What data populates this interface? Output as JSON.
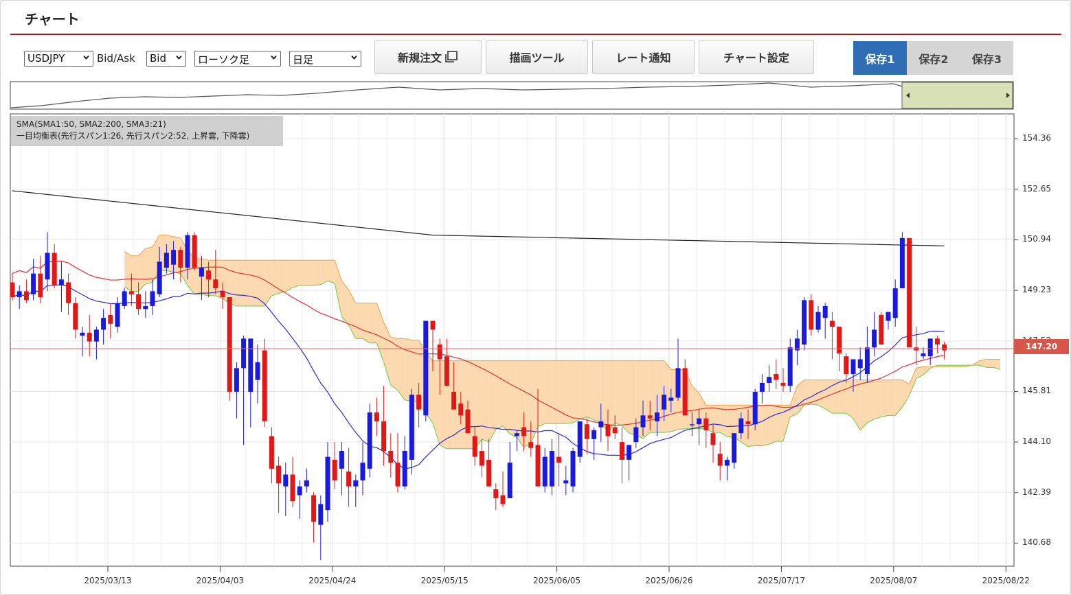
{
  "page_title": "チャート",
  "toolbar": {
    "symbol": "USDJPY",
    "bidask_label": "Bid/Ask",
    "bidask_value": "Bid",
    "chart_type": "ローソク足",
    "period": "日足",
    "new_order": "新規注文",
    "draw_tools": "描画ツール",
    "rate_alert": "レート通知",
    "chart_settings": "チャート設定",
    "save1": "保存1",
    "save2": "保存2",
    "save3": "保存3"
  },
  "legend": {
    "line1": "SMA(SMA1:50, SMA2:200, SMA3:21)",
    "line2": "一目均衡表(先行スパン1:26, 先行スパン2:52, 上昇雲, 下降雲)"
  },
  "current_price": "147.20",
  "icons": {
    "new_order_icon": "window-open-icon",
    "dropdown": "chevron-down-icon"
  },
  "colors": {
    "active_save": "#2f6db5",
    "up_candle": "#1a1adf",
    "down_candle": "#e01818",
    "bull_cloud": "#b6f0a8",
    "bear_cloud": "#fdd9b0",
    "price_line": "#d8554a"
  },
  "chart_data": {
    "type": "candlestick",
    "y_ticks": [
      "154.36",
      "152.65",
      "150.94",
      "149.23",
      "147.52",
      "145.81",
      "144.10",
      "142.39",
      "140.68"
    ],
    "ylim": [
      139.9,
      155.2
    ],
    "x_ticks": [
      "2025/03/13",
      "2025/04/03",
      "2025/04/24",
      "2025/05/15",
      "2025/06/05",
      "2025/06/26",
      "2025/07/17",
      "2025/08/07",
      "2025/08/22"
    ],
    "current_price": 147.2,
    "candles_ohlc": [
      [
        149.5,
        149.8,
        148.9,
        149.0
      ],
      [
        149.0,
        149.4,
        148.6,
        149.2
      ],
      [
        149.2,
        149.6,
        148.8,
        148.9
      ],
      [
        149.1,
        150.3,
        148.9,
        149.8
      ],
      [
        149.8,
        150.4,
        148.8,
        149.0
      ],
      [
        149.6,
        151.2,
        149.2,
        150.5
      ],
      [
        150.5,
        150.8,
        149.3,
        149.4
      ],
      [
        149.4,
        150.2,
        148.5,
        149.6
      ],
      [
        149.5,
        149.8,
        148.4,
        148.8
      ],
      [
        148.8,
        149.0,
        147.6,
        147.9
      ],
      [
        147.7,
        148.0,
        147.0,
        147.8
      ],
      [
        147.8,
        148.4,
        147.0,
        147.5
      ],
      [
        147.5,
        148.0,
        146.9,
        147.9
      ],
      [
        147.9,
        148.6,
        147.4,
        148.3
      ],
      [
        148.4,
        148.8,
        147.6,
        148.1
      ],
      [
        148.0,
        149.0,
        147.8,
        148.8
      ],
      [
        148.7,
        149.3,
        148.6,
        149.2
      ],
      [
        149.2,
        149.8,
        148.7,
        149.1
      ],
      [
        149.1,
        149.5,
        148.4,
        148.6
      ],
      [
        148.6,
        149.2,
        148.3,
        148.7
      ],
      [
        148.7,
        149.6,
        148.4,
        149.2
      ],
      [
        149.1,
        150.7,
        149.0,
        150.2
      ],
      [
        150.0,
        150.8,
        149.8,
        150.5
      ],
      [
        150.1,
        150.9,
        149.6,
        150.6
      ],
      [
        150.6,
        150.7,
        149.5,
        150.0
      ],
      [
        150.0,
        151.2,
        149.6,
        151.1
      ],
      [
        151.1,
        151.2,
        149.9,
        150.0
      ],
      [
        149.7,
        150.4,
        148.9,
        150.0
      ],
      [
        149.9,
        150.2,
        149.0,
        149.6
      ],
      [
        149.6,
        150.6,
        149.1,
        149.3
      ],
      [
        149.2,
        149.5,
        148.6,
        149.0
      ],
      [
        149.0,
        149.0,
        145.5,
        145.8
      ],
      [
        145.8,
        146.8,
        144.9,
        146.6
      ],
      [
        146.6,
        147.7,
        144.0,
        147.6
      ],
      [
        145.8,
        147.2,
        144.6,
        147.6
      ],
      [
        146.2,
        147.4,
        145.4,
        146.8
      ],
      [
        147.2,
        147.6,
        144.6,
        144.8
      ],
      [
        144.3,
        144.6,
        142.7,
        143.2
      ],
      [
        143.3,
        143.6,
        141.7,
        142.7
      ],
      [
        142.6,
        143.4,
        141.6,
        143.0
      ],
      [
        143.0,
        143.6,
        141.9,
        142.1
      ],
      [
        142.3,
        142.8,
        141.5,
        142.6
      ],
      [
        142.6,
        143.2,
        142.4,
        142.8
      ],
      [
        142.3,
        142.4,
        140.7,
        141.4
      ],
      [
        141.3,
        142.3,
        140.1,
        142.0
      ],
      [
        141.8,
        144.1,
        141.4,
        143.6
      ],
      [
        143.5,
        144.1,
        142.5,
        142.8
      ],
      [
        143.2,
        144.1,
        142.3,
        143.8
      ],
      [
        143.1,
        143.9,
        141.9,
        142.6
      ],
      [
        142.6,
        143.0,
        141.9,
        142.8
      ],
      [
        142.8,
        144.1,
        142.3,
        143.4
      ],
      [
        143.2,
        145.4,
        142.9,
        145.1
      ],
      [
        145.1,
        145.6,
        144.3,
        144.8
      ],
      [
        144.8,
        146.0,
        143.3,
        143.8
      ],
      [
        143.8,
        144.4,
        142.9,
        143.4
      ],
      [
        143.4,
        144.4,
        142.4,
        142.6
      ],
      [
        142.6,
        144.3,
        142.5,
        143.8
      ],
      [
        143.5,
        145.9,
        143.0,
        145.7
      ],
      [
        145.7,
        146.1,
        144.6,
        145.2
      ],
      [
        145.0,
        148.0,
        144.8,
        148.2
      ],
      [
        148.2,
        148.2,
        146.5,
        147.9
      ],
      [
        147.4,
        147.6,
        145.7,
        146.9
      ],
      [
        147.0,
        147.6,
        146.0,
        146.0
      ],
      [
        145.8,
        146.8,
        145.5,
        145.2
      ],
      [
        145.4,
        145.8,
        144.7,
        145.0
      ],
      [
        145.2,
        145.5,
        144.4,
        144.4
      ],
      [
        144.3,
        144.6,
        143.3,
        143.6
      ],
      [
        143.8,
        144.2,
        142.9,
        143.3
      ],
      [
        143.5,
        144.2,
        142.6,
        142.6
      ],
      [
        142.5,
        142.7,
        141.8,
        142.2
      ],
      [
        142.3,
        143.1,
        141.9,
        142.0
      ],
      [
        142.2,
        144.1,
        142.2,
        143.4
      ],
      [
        144.3,
        144.5,
        143.8,
        144.4
      ],
      [
        144.6,
        145.1,
        143.8,
        144.3
      ],
      [
        144.1,
        144.8,
        143.6,
        143.9
      ],
      [
        144.0,
        145.9,
        143.0,
        142.6
      ],
      [
        142.6,
        143.9,
        142.4,
        143.6
      ],
      [
        142.6,
        144.2,
        142.3,
        143.8
      ],
      [
        143.6,
        144.4,
        142.6,
        143.4
      ],
      [
        142.7,
        143.3,
        142.3,
        142.8
      ],
      [
        142.6,
        143.9,
        142.4,
        143.8
      ],
      [
        143.6,
        144.8,
        143.4,
        144.8
      ],
      [
        144.7,
        144.9,
        143.7,
        144.2
      ],
      [
        144.2,
        144.6,
        143.5,
        144.5
      ],
      [
        144.6,
        145.4,
        144.1,
        144.8
      ],
      [
        144.7,
        145.2,
        143.8,
        144.3
      ],
      [
        144.6,
        145.0,
        144.2,
        144.4
      ],
      [
        144.1,
        144.6,
        142.7,
        143.5
      ],
      [
        143.5,
        144.0,
        142.8,
        144.0
      ],
      [
        144.1,
        144.9,
        143.9,
        144.6
      ],
      [
        144.6,
        145.5,
        144.3,
        145.0
      ],
      [
        145.0,
        145.5,
        144.5,
        144.9
      ],
      [
        144.8,
        145.7,
        144.3,
        145.1
      ],
      [
        145.2,
        146.0,
        144.8,
        145.7
      ],
      [
        145.5,
        145.9,
        145.1,
        145.6
      ],
      [
        145.6,
        147.6,
        145.5,
        146.6
      ],
      [
        146.6,
        146.9,
        145.6,
        145.0
      ],
      [
        144.7,
        145.1,
        144.3,
        144.7
      ],
      [
        144.7,
        145.2,
        144.0,
        144.9
      ],
      [
        144.9,
        145.1,
        143.9,
        144.5
      ],
      [
        144.4,
        144.7,
        143.4,
        144.0
      ],
      [
        143.7,
        144.1,
        142.8,
        143.3
      ],
      [
        143.3,
        143.6,
        142.8,
        143.5
      ],
      [
        143.4,
        144.1,
        143.2,
        144.4
      ],
      [
        144.4,
        145.1,
        144.2,
        144.9
      ],
      [
        144.8,
        145.2,
        144.2,
        144.7
      ],
      [
        144.7,
        145.9,
        144.5,
        145.8
      ],
      [
        145.8,
        146.4,
        145.4,
        146.1
      ],
      [
        146.1,
        146.7,
        145.8,
        146.3
      ],
      [
        146.4,
        146.9,
        145.9,
        146.2
      ],
      [
        146.1,
        146.6,
        145.8,
        146.0
      ],
      [
        146.0,
        147.6,
        145.8,
        147.3
      ],
      [
        147.2,
        147.9,
        146.7,
        147.6
      ],
      [
        147.4,
        149.0,
        147.2,
        148.9
      ],
      [
        148.9,
        149.1,
        147.7,
        147.9
      ],
      [
        147.9,
        148.7,
        147.8,
        148.5
      ],
      [
        148.3,
        148.8,
        147.6,
        148.7
      ],
      [
        148.2,
        148.5,
        146.9,
        148.0
      ],
      [
        148.0,
        148.0,
        146.5,
        147.1
      ],
      [
        147.0,
        147.1,
        146.1,
        146.4
      ],
      [
        146.4,
        146.9,
        145.8,
        146.9
      ],
      [
        146.6,
        147.3,
        146.2,
        146.9
      ],
      [
        146.4,
        148.0,
        146.1,
        147.3
      ],
      [
        147.3,
        148.5,
        147.0,
        147.9
      ],
      [
        148.4,
        148.5,
        147.7,
        147.4
      ],
      [
        148.2,
        148.4,
        147.9,
        148.5
      ],
      [
        148.3,
        149.6,
        148.0,
        149.3
      ],
      [
        149.3,
        151.2,
        149.3,
        151.0
      ],
      [
        151.0,
        151.0,
        147.5,
        147.3
      ],
      [
        147.3,
        148.0,
        146.7,
        147.2
      ],
      [
        147.0,
        147.3,
        146.9,
        147.1
      ],
      [
        147.0,
        147.4,
        146.7,
        147.6
      ],
      [
        147.6,
        147.7,
        147.1,
        147.4
      ],
      [
        147.4,
        147.5,
        146.9,
        147.2
      ]
    ]
  }
}
